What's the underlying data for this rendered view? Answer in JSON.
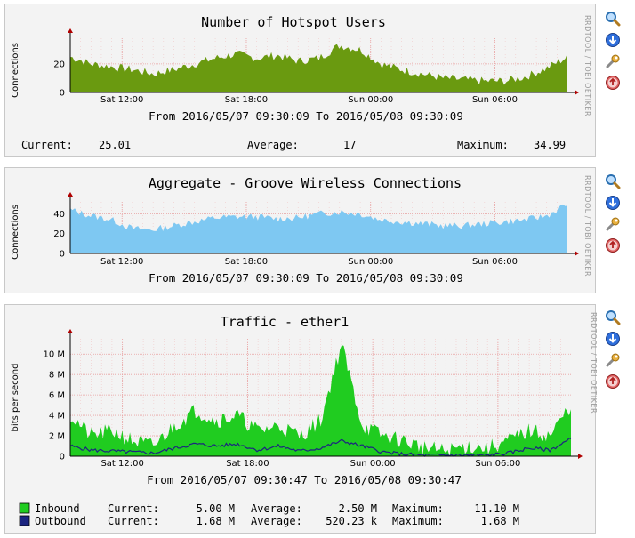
{
  "credit": "RRDTOOL / TOBI OETIKER",
  "graphs": [
    {
      "title": "Number of Hotspot Users",
      "ylabel": "Connections",
      "from_line": "From 2016/05/07 09:30:09 To 2016/05/08 09:30:09",
      "stats": {
        "current_label": "Current:",
        "current": "25.01",
        "average_label": "Average:",
        "average": "17",
        "maximum_label": "Maximum:",
        "maximum": "34.99"
      }
    },
    {
      "title": "Aggregate - Groove Wireless Connections",
      "ylabel": "Connections",
      "from_line": "From 2016/05/07 09:30:09 To 2016/05/08 09:30:09"
    },
    {
      "title": "Traffic - ether1",
      "ylabel": "bits per second",
      "from_line": "From 2016/05/07 09:30:47 To 2016/05/08 09:30:47",
      "legend": {
        "inbound": {
          "name": "Inbound",
          "current_label": "Current:",
          "current": "5.00 M",
          "average_label": "Average:",
          "average": "2.50 M",
          "maximum_label": "Maximum:",
          "maximum": "11.10 M"
        },
        "outbound": {
          "name": "Outbound",
          "current_label": "Current:",
          "current": "1.68 M",
          "average_label": "Average:",
          "average": "520.23 k",
          "maximum_label": "Maximum:",
          "maximum": "1.68 M"
        }
      }
    }
  ],
  "colors": {
    "hotspot": "#6a9a10",
    "aggregate": "#7ec8f2",
    "inbound": "#20cc20",
    "outbound": "#1b2480",
    "grid": "#e8a0a0",
    "axis": "#b00000"
  },
  "tools": [
    "zoom-icon",
    "download-icon",
    "settings-wrench-icon",
    "remove-icon"
  ],
  "chart_data": [
    {
      "type": "area",
      "title": "Number of Hotspot Users",
      "ylabel": "Connections",
      "x_ticks": [
        "Sat 12:00",
        "Sat 18:00",
        "Sun 00:00",
        "Sun 06:00"
      ],
      "x": [
        "09:30",
        "10:30",
        "11:30",
        "12:30",
        "13:30",
        "14:30",
        "15:30",
        "16:30",
        "17:30",
        "18:30",
        "19:30",
        "20:30",
        "21:30",
        "22:30",
        "23:30",
        "00:30",
        "01:30",
        "02:30",
        "03:30",
        "04:30",
        "05:30",
        "06:30",
        "07:30",
        "08:30",
        "09:30"
      ],
      "y_ticks": [
        0,
        20
      ],
      "ylim": [
        0,
        38
      ],
      "values": [
        25,
        20,
        18,
        16,
        13,
        16,
        20,
        24,
        27,
        24,
        26,
        22,
        24,
        33,
        30,
        20,
        16,
        13,
        10,
        9,
        8,
        8,
        11,
        17,
        25
      ],
      "grid": true
    },
    {
      "type": "area",
      "title": "Aggregate - Groove Wireless Connections",
      "ylabel": "Connections",
      "x_ticks": [
        "Sat 12:00",
        "Sat 18:00",
        "Sun 00:00",
        "Sun 06:00"
      ],
      "x": [
        "09:30",
        "10:30",
        "11:30",
        "12:30",
        "13:30",
        "14:30",
        "15:30",
        "16:30",
        "17:30",
        "18:30",
        "19:30",
        "20:30",
        "21:30",
        "22:30",
        "23:30",
        "00:30",
        "01:30",
        "02:30",
        "03:30",
        "04:30",
        "05:30",
        "06:30",
        "07:30",
        "08:30",
        "09:30"
      ],
      "y_ticks": [
        0,
        20,
        40
      ],
      "ylim": [
        0,
        52
      ],
      "values": [
        44,
        38,
        34,
        25,
        24,
        28,
        32,
        36,
        37,
        37,
        35,
        36,
        40,
        42,
        40,
        34,
        32,
        30,
        28,
        28,
        30,
        32,
        34,
        38,
        50
      ],
      "grid": true
    },
    {
      "type": "area",
      "title": "Traffic - ether1",
      "ylabel": "bits per second",
      "x_ticks": [
        "Sat 12:00",
        "Sat 18:00",
        "Sun 00:00",
        "Sun 06:00"
      ],
      "x": [
        "09:30",
        "10:30",
        "11:30",
        "12:30",
        "13:30",
        "14:30",
        "15:30",
        "16:30",
        "17:30",
        "18:30",
        "19:30",
        "20:30",
        "21:30",
        "22:30",
        "23:30",
        "00:30",
        "01:30",
        "02:30",
        "03:30",
        "04:30",
        "05:30",
        "06:30",
        "07:30",
        "08:30",
        "09:30"
      ],
      "y_ticks": [
        "0",
        "2 M",
        "4 M",
        "6 M",
        "8 M",
        "10 M"
      ],
      "ylim": [
        0,
        11.5
      ],
      "series": [
        {
          "name": "Inbound",
          "values": [
            4.0,
            2.0,
            2.5,
            1.5,
            1.0,
            3.0,
            4.5,
            3.5,
            4.0,
            2.5,
            3.0,
            2.0,
            3.5,
            11.0,
            3.0,
            2.0,
            1.5,
            0.8,
            0.5,
            1.0,
            0.8,
            1.5,
            2.5,
            2.0,
            5.0
          ]
        },
        {
          "name": "Outbound",
          "values": [
            1.0,
            0.6,
            0.5,
            0.4,
            0.3,
            0.8,
            1.2,
            1.0,
            1.2,
            0.6,
            1.0,
            0.5,
            0.8,
            1.5,
            1.0,
            0.4,
            0.2,
            0.1,
            0.1,
            0.1,
            0.1,
            0.3,
            0.8,
            0.6,
            1.7
          ]
        }
      ],
      "grid": true
    }
  ]
}
